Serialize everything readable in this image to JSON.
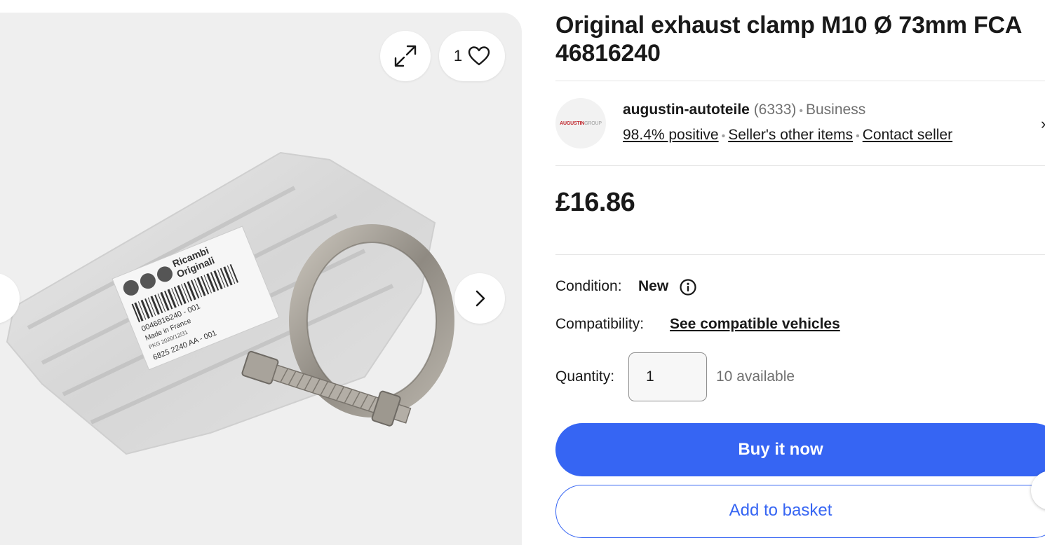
{
  "product": {
    "title": "Original exhaust clamp M10 Ø 73mm FCA 46816240",
    "price": "£16.86"
  },
  "gallery": {
    "watch_count": "1",
    "label_text": {
      "brand_line1": "Ricambi",
      "brand_line2": "Originali",
      "part_number": "0046816240 - 001",
      "origin": "Made in France",
      "pkg": "PKG 2020/12/31",
      "code": "6825 2240 AA - 001"
    }
  },
  "seller": {
    "logo_part1": "AUGUSTIN",
    "logo_part2": "GROUP",
    "name": "augustin-autoteile",
    "count": "(6333)",
    "type": "Business",
    "feedback": "98.4% positive",
    "other_items": "Seller's other items",
    "contact": "Contact seller"
  },
  "details": {
    "condition_label": "Condition:",
    "condition_value": "New",
    "compat_label": "Compatibility:",
    "compat_link": "See compatible vehicles",
    "quantity_label": "Quantity:",
    "quantity_value": "1",
    "available": "10 available"
  },
  "actions": {
    "buy_now": "Buy it now",
    "add_to_basket": "Add to basket"
  },
  "colors": {
    "accent": "#3665f3",
    "gallery_bg": "#efefef"
  }
}
